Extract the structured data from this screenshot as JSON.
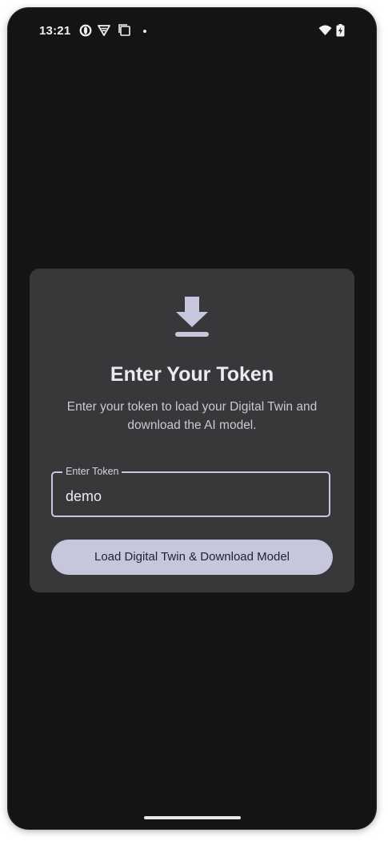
{
  "status_bar": {
    "time": "13:21",
    "icons": [
      "opera-icon",
      "vpn-icon",
      "screenshot-icon",
      "notification-dot",
      "wifi-icon",
      "battery-charging-icon"
    ]
  },
  "card": {
    "icon": "download-icon",
    "title": "Enter Your Token",
    "description": "Enter your token to load your Digital Twin and download the AI model.",
    "token_field": {
      "label": "Enter Token",
      "value": "demo"
    },
    "button_label": "Load Digital Twin & Download Model"
  },
  "colors": {
    "background": "#141416",
    "card": "#38383a",
    "accent": "#c6c7dd",
    "text_primary": "#ececf0",
    "text_secondary": "#c9c9ce"
  }
}
